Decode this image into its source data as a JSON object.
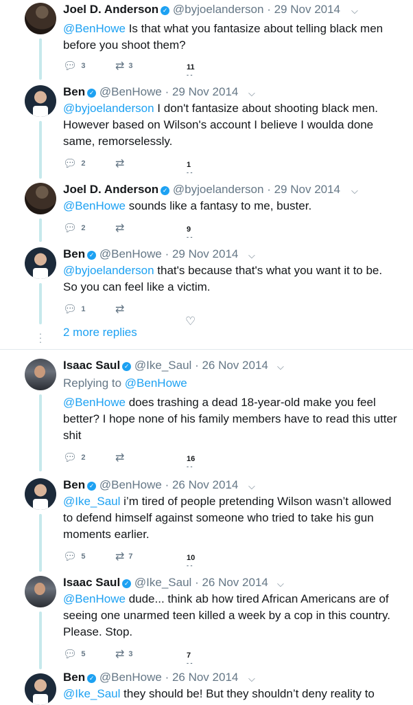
{
  "tweets": [
    {
      "name": "Joel D. Anderson",
      "handle": "@byjoelanderson",
      "date": "· 29 Nov 2014",
      "mention": "@BenHowe",
      "text": " Is that what you fantasize about telling black men before you shoot them?",
      "replies": "3",
      "retweets": "3",
      "likes": "11"
    },
    {
      "name": "Ben",
      "handle": "@BenHowe",
      "date": "· 29 Nov 2014",
      "mention": "@byjoelanderson",
      "text": " I don't fantasize about shooting black men. However based on Wilson's account I believe I woulda done same, remorselessly.",
      "replies": "2",
      "retweets": "",
      "likes": "1"
    },
    {
      "name": "Joel D. Anderson",
      "handle": "@byjoelanderson",
      "date": "· 29 Nov 2014",
      "mention": "@BenHowe",
      "text": " sounds like a fantasy to me, buster.",
      "replies": "2",
      "retweets": "",
      "likes": "9"
    },
    {
      "name": "Ben",
      "handle": "@BenHowe",
      "date": "· 29 Nov 2014",
      "mention": "@byjoelanderson",
      "text": " that's because that's what you want it to be. So you can feel like a victim.",
      "replies": "1",
      "retweets": "",
      "likes": ""
    },
    {
      "name": "Isaac Saul",
      "handle": "@Ike_Saul",
      "date": "· 26 Nov 2014",
      "replying_prefix": "Replying to ",
      "replying_to": "@BenHowe",
      "mention": "@BenHowe",
      "text": " does trashing a dead 18-year-old make you feel better? I hope none of his family members have to read this utter shit",
      "replies": "2",
      "retweets": "",
      "likes": "16"
    },
    {
      "name": "Ben",
      "handle": "@BenHowe",
      "date": "· 26 Nov 2014",
      "mention": "@Ike_Saul",
      "text": " i’m tired of people pretending Wilson wasn’t allowed to defend himself against someone who tried to take his gun moments earlier.",
      "replies": "5",
      "retweets": "7",
      "likes": "10"
    },
    {
      "name": "Isaac Saul",
      "handle": "@Ike_Saul",
      "date": "· 26 Nov 2014",
      "mention": "@BenHowe",
      "text": " dude... think ab how tired African Americans are of seeing one unarmed teen killed a week by a cop in this country. Please. Stop.",
      "replies": "5",
      "retweets": "3",
      "likes": "7"
    },
    {
      "name": "Ben",
      "handle": "@BenHowe",
      "date": "· 26 Nov 2014",
      "mention": "@Ike_Saul",
      "text": " they should be! But they shouldn’t deny reality to",
      "replies": "",
      "retweets": "",
      "likes": ""
    }
  ],
  "more_replies": "2 more replies",
  "icons": {
    "reply": "reply-icon",
    "retweet": "retweet-icon",
    "like": "heart-icon",
    "caret": "chevron-down-icon",
    "verified": "verified-badge-icon"
  },
  "colors": {
    "link": "#1da1f2",
    "muted": "#657786",
    "thread": "#c6e9ec",
    "verified": "#1da1f2"
  }
}
